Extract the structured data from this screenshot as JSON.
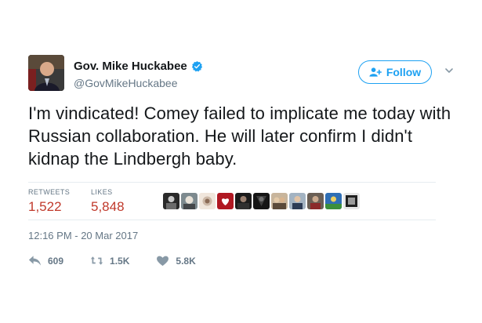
{
  "user": {
    "display_name": "Gov. Mike Huckabee",
    "handle": "@GovMikeHuckabee",
    "avatar_icon": "profile-photo",
    "verified_icon": "verified-badge-icon"
  },
  "follow_button": {
    "label": "Follow",
    "icon": "add-user-icon"
  },
  "tweet": {
    "text": "I'm vindicated! Comey failed to implicate me today with Russian collaboration. He will later confirm I didn't kidnap the Lindbergh baby."
  },
  "stats": {
    "retweets_label": "RETWEETS",
    "retweets_value": "1,522",
    "likes_label": "LIKES",
    "likes_value": "5,848"
  },
  "likers": [
    "liker-avatar",
    "liker-avatar",
    "liker-avatar",
    "liker-avatar",
    "liker-avatar",
    "liker-avatar",
    "liker-avatar",
    "liker-avatar",
    "liker-avatar",
    "liker-avatar",
    "liker-avatar"
  ],
  "timestamp": "12:16 PM - 20 Mar 2017",
  "actions": {
    "reply_count": "609",
    "retweet_count": "1.5K",
    "like_count": "5.8K"
  },
  "colors": {
    "accent": "#1da1f2",
    "text": "#14171a",
    "muted": "#657786",
    "stat_red": "#c0392b"
  }
}
